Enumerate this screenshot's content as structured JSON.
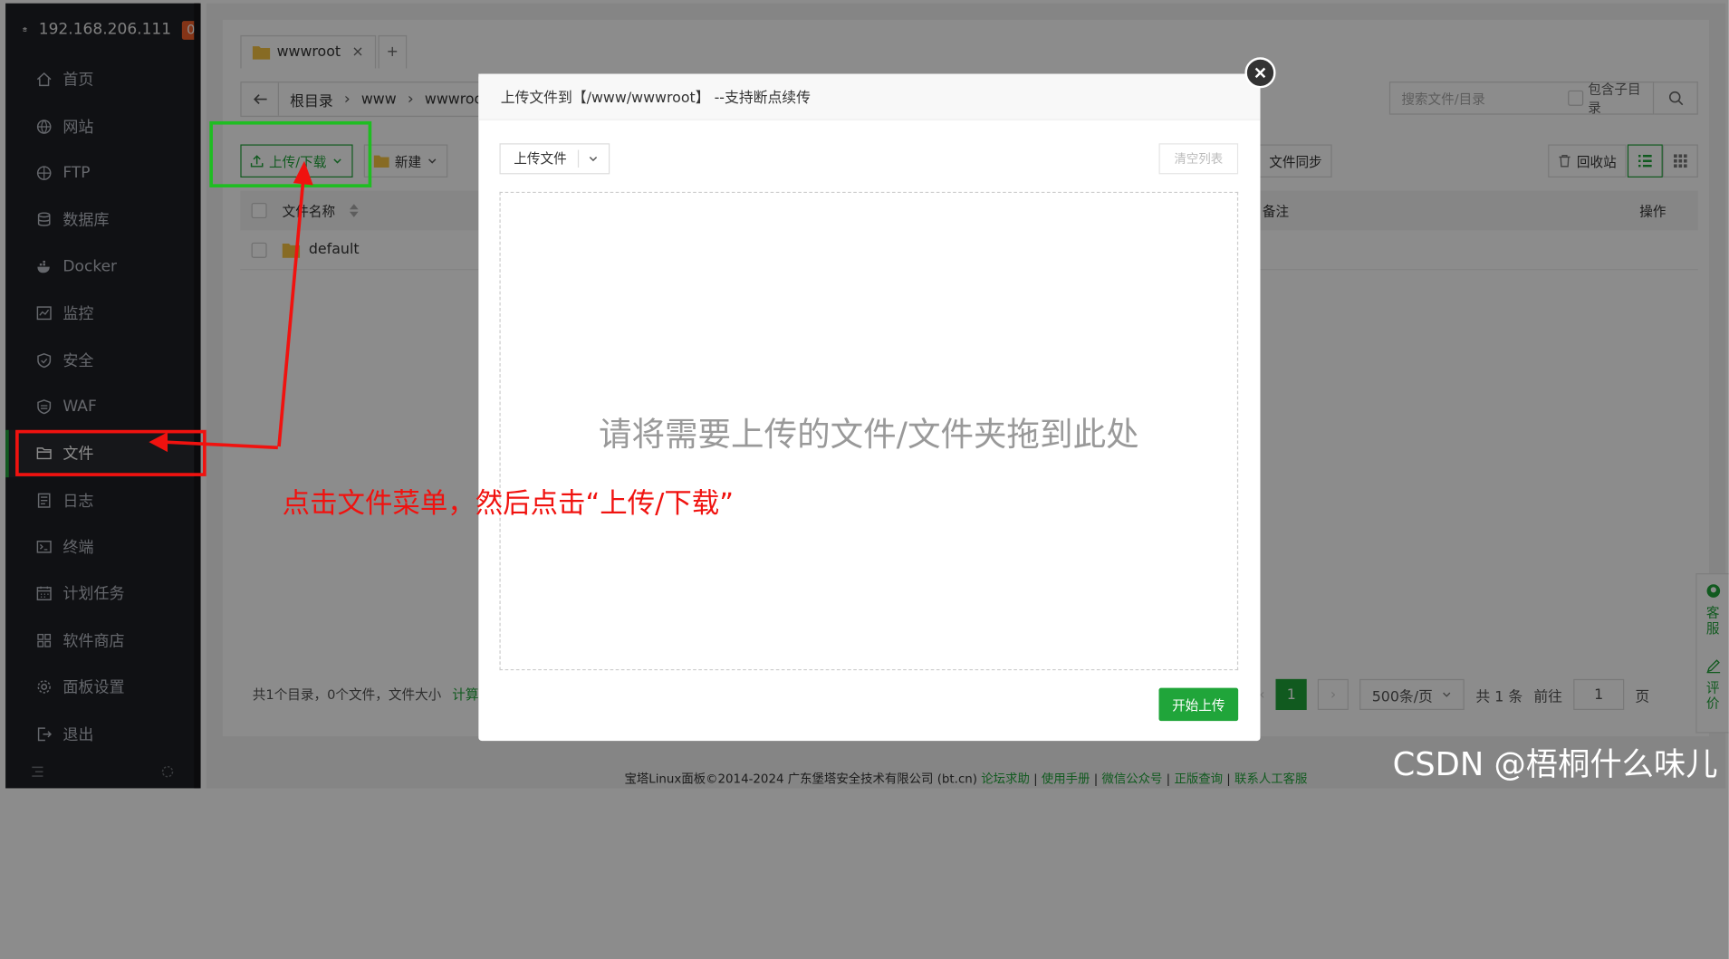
{
  "sidebar": {
    "host_ip": "192.168.206.111",
    "badge": "0",
    "items": [
      {
        "label": "首页",
        "icon": "home-icon"
      },
      {
        "label": "网站",
        "icon": "globe-icon"
      },
      {
        "label": "FTP",
        "icon": "ftp-icon"
      },
      {
        "label": "数据库",
        "icon": "database-icon"
      },
      {
        "label": "Docker",
        "icon": "docker-icon"
      },
      {
        "label": "监控",
        "icon": "monitor-icon"
      },
      {
        "label": "安全",
        "icon": "shield-icon"
      },
      {
        "label": "WAF",
        "icon": "waf-icon"
      },
      {
        "label": "文件",
        "icon": "folder-icon",
        "active": true
      },
      {
        "label": "日志",
        "icon": "log-icon"
      },
      {
        "label": "终端",
        "icon": "terminal-icon"
      },
      {
        "label": "计划任务",
        "icon": "calendar-icon"
      },
      {
        "label": "软件商店",
        "icon": "grid-icon"
      },
      {
        "label": "面板设置",
        "icon": "gear-icon"
      },
      {
        "label": "退出",
        "icon": "logout-icon"
      }
    ]
  },
  "file_manager": {
    "tab_label": "wwwroot",
    "tab_close": "×",
    "tab_add": "+",
    "path": [
      "根目录",
      "www",
      "wwwroot"
    ],
    "search_placeholder": "搜索文件/目录",
    "include_subdir": "包含子目录",
    "upload_download_btn": "上传/下载",
    "new_btn": "新建",
    "sync_btn": "文件同步",
    "recycle_btn": "回收站",
    "col_name": "文件名称",
    "col_note": "备注",
    "col_action": "操作",
    "rows": [
      {
        "name": "default"
      }
    ],
    "summary_text": "共1个目录，0个文件，文件大小",
    "summary_link": "计算",
    "page_current": "1",
    "page_size": "500条/页",
    "total": "共 1 条",
    "goto_label": "前往",
    "goto_value": "1",
    "page_unit": "页"
  },
  "footer": {
    "copyright": "宝塔Linux面板©2014-2024 广东堡塔安全技术有限公司 (bt.cn)",
    "links": [
      "论坛求助",
      "使用手册",
      "微信公众号",
      "正版查询",
      "联系人工客服"
    ]
  },
  "side_tabs": {
    "service": "客服",
    "review": "评价"
  },
  "upload_modal": {
    "title": "上传文件到【/www/wwwroot】 --支持断点续传",
    "select_label": "上传文件",
    "clear_btn": "清空列表",
    "drop_hint": "请将需要上传的文件/文件夹拖到此处",
    "start_btn": "开始上传"
  },
  "annotation": {
    "text": "点击文件菜单，然后点击“上传/下载”",
    "color": "#f0120f"
  },
  "watermark": "CSDN @梧桐什么味儿",
  "colors": {
    "accent": "#20a53a",
    "sidebar_bg": "#1e2025",
    "badge": "#f0602b",
    "highlight_green": "#1fbd22"
  }
}
